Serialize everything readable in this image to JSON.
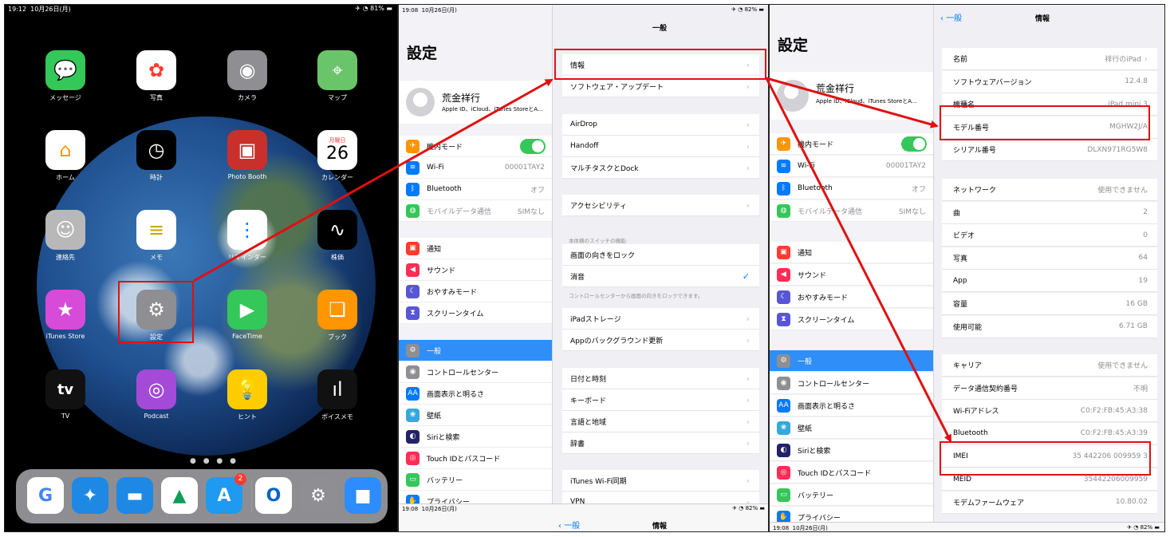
{
  "panel1": {
    "status": {
      "time": "19:12",
      "date": "10月26日(月)",
      "battery": "81%"
    },
    "apps": [
      {
        "label": "メッセージ",
        "icon": "messages-icon",
        "color": "#34c759"
      },
      {
        "label": "写真",
        "icon": "photos-icon",
        "color": "#ffffff"
      },
      {
        "label": "カメラ",
        "icon": "camera-icon",
        "color": "#8e8e93"
      },
      {
        "label": "マップ",
        "icon": "maps-icon",
        "color": "#6ac46a"
      },
      {
        "label": "ホーム",
        "icon": "home-icon",
        "color": "#ffffff"
      },
      {
        "label": "時計",
        "icon": "clock-icon",
        "color": "#000000"
      },
      {
        "label": "Photo Booth",
        "icon": "photobooth-icon",
        "color": "#c9302c"
      },
      {
        "label": "カレンダー",
        "icon": "calendar-icon",
        "color": "#ffffff"
      },
      {
        "label": "連絡先",
        "icon": "contacts-icon",
        "color": "#b8b8b8"
      },
      {
        "label": "メモ",
        "icon": "notes-icon",
        "color": "#ffffff"
      },
      {
        "label": "リマインダー",
        "icon": "reminders-icon",
        "color": "#ffffff"
      },
      {
        "label": "株価",
        "icon": "stocks-icon",
        "color": "#000000"
      },
      {
        "label": "iTunes Store",
        "icon": "star-icon",
        "color": "#d64bd8"
      },
      {
        "label": "設定",
        "icon": "settings-gear-icon",
        "color": "#8e8e93"
      },
      {
        "label": "FaceTime",
        "icon": "facetime-icon",
        "color": "#34c759"
      },
      {
        "label": "ブック",
        "icon": "books-icon",
        "color": "#ff9500"
      },
      {
        "label": "TV",
        "icon": "tv-icon",
        "color": "#111111"
      },
      {
        "label": "Podcast",
        "icon": "podcast-icon",
        "color": "#a34ad8"
      },
      {
        "label": "ヒント",
        "icon": "lightbulb-icon",
        "color": "#ffcc00"
      },
      {
        "label": "ボイスメモ",
        "icon": "voice-memo-icon",
        "color": "#111111"
      }
    ],
    "calendar": {
      "weekday": "月曜日",
      "day": "26"
    },
    "tv_label": "tv",
    "dots": "● ● ● ●",
    "dock": [
      {
        "icon": "google-icon",
        "glyph": "G",
        "color": "#ffffff",
        "fg": "#4285f4"
      },
      {
        "icon": "safari-icon",
        "glyph": "✦",
        "color": "#1e88e5",
        "fg": "#ffffff"
      },
      {
        "icon": "files-icon",
        "glyph": "▬",
        "color": "#1e88e5",
        "fg": "#ffffff"
      },
      {
        "icon": "drive-icon",
        "glyph": "▲",
        "color": "#ffffff",
        "fg": "#0f9d58"
      },
      {
        "icon": "app-store-icon",
        "glyph": "A",
        "color": "#1e9bf0",
        "fg": "#ffffff",
        "badge": "2"
      },
      {
        "icon": "outlook-icon",
        "glyph": "O",
        "color": "#ffffff",
        "fg": "#0a64c4"
      },
      {
        "icon": "settings-gear-icon",
        "glyph": "⚙",
        "color": "#8e8e93",
        "fg": "#ffffff"
      },
      {
        "icon": "zoom-icon",
        "glyph": "■",
        "color": "#2d8cff",
        "fg": "#ffffff"
      }
    ]
  },
  "panel2": {
    "status": {
      "time": "19:08",
      "date": "10月26日(月)",
      "battery": "82%"
    },
    "sidebar_title": "設定",
    "profile": {
      "name": "荒金祥行",
      "sub": "Apple ID、iCloud、iTunes StoreとA..."
    },
    "rows": [
      {
        "label": "機内モード",
        "value": "",
        "color": "#ff9500",
        "glyph": "✈"
      },
      {
        "label": "Wi-Fi",
        "value": "00001TAY2",
        "color": "#007aff",
        "glyph": "≋"
      },
      {
        "label": "Bluetooth",
        "value": "オフ",
        "color": "#007aff",
        "glyph": "ᛒ"
      },
      {
        "label": "モバイルデータ通信",
        "value": "SIMなし",
        "color": "#34c759",
        "glyph": "◍"
      },
      {
        "label": "通知",
        "value": "",
        "color": "#ff3b30",
        "glyph": "▣"
      },
      {
        "label": "サウンド",
        "value": "",
        "color": "#ff2d55",
        "glyph": "◀"
      },
      {
        "label": "おやすみモード",
        "value": "",
        "color": "#5856d6",
        "glyph": "☾"
      },
      {
        "label": "スクリーンタイム",
        "value": "",
        "color": "#5856d6",
        "glyph": "⧗"
      },
      {
        "label": "一般",
        "value": "",
        "color": "#8e8e93",
        "glyph": "⚙"
      },
      {
        "label": "コントロールセンター",
        "value": "",
        "color": "#8e8e93",
        "glyph": "◉"
      },
      {
        "label": "画面表示と明るさ",
        "value": "",
        "color": "#007aff",
        "glyph": "AA"
      },
      {
        "label": "壁紙",
        "value": "",
        "color": "#34aadc",
        "glyph": "❀"
      },
      {
        "label": "Siriと検索",
        "value": "",
        "color": "#222266",
        "glyph": "◐"
      },
      {
        "label": "Touch IDとパスコード",
        "value": "",
        "color": "#ff2d55",
        "glyph": "◎"
      },
      {
        "label": "バッテリー",
        "value": "",
        "color": "#34c759",
        "glyph": "▭"
      },
      {
        "label": "プライバシー",
        "value": "",
        "color": "#007aff",
        "glyph": "✋"
      }
    ],
    "main_title": "一般",
    "main_groups": [
      [
        "情報",
        "ソフトウェア・アップデート"
      ],
      [
        "AirDrop",
        "Handoff",
        "マルチタスクとDock"
      ],
      [
        "アクセシビリティ"
      ],
      [
        "画面の向きをロック",
        "消音"
      ],
      [
        "iPadストレージ",
        "Appのバックグラウンド更新"
      ],
      [
        "日付と時刻",
        "キーボード",
        "言語と地域",
        "辞書"
      ],
      [
        "iTunes Wi-Fi同期",
        "VPN"
      ]
    ],
    "switch_caption": "本体横のスイッチの機能:",
    "switch_note": "コントロールセンターから画面の向きをロックできます。",
    "checkmark": "✓",
    "bottom_status": {
      "time": "19:08",
      "date": "10月26日(月)",
      "battery": "82%"
    },
    "bottom_back": "一般",
    "bottom_title": "情報"
  },
  "panel3": {
    "sidebar_title": "設定",
    "back_label": "一般",
    "title": "情報",
    "info_groups": [
      [
        [
          "名前",
          "祥行のiPad"
        ],
        [
          "ソフトウェアバージョン",
          "12.4.8"
        ],
        [
          "機種名",
          "iPad mini 3"
        ],
        [
          "モデル番号",
          "MGHW2J/A"
        ],
        [
          "シリアル番号",
          "DLXN971RG5W8"
        ]
      ],
      [
        [
          "ネットワーク",
          "使用できません"
        ],
        [
          "曲",
          "2"
        ],
        [
          "ビデオ",
          "0"
        ],
        [
          "写真",
          "64"
        ],
        [
          "App",
          "19"
        ],
        [
          "容量",
          "16 GB"
        ],
        [
          "使用可能",
          "6.71 GB"
        ]
      ],
      [
        [
          "キャリア",
          "使用できません"
        ],
        [
          "データ通信契約番号",
          "不明"
        ],
        [
          "Wi-Fiアドレス",
          "C0:F2:FB:45:A3:38"
        ],
        [
          "Bluetooth",
          "C0:F2:FB:45:A3:39"
        ],
        [
          "IMEI",
          "35 442206 009959 3"
        ],
        [
          "MEID",
          "35442206009959"
        ],
        [
          "モデムファームウェア",
          "10.80.02"
        ]
      ]
    ],
    "bottom_status": {
      "time": "19:08",
      "date": "10月26日(月)",
      "battery": "82%"
    }
  },
  "colors": {
    "highlight": "#e01010",
    "accent": "#2f8ef7",
    "toggle_on": "#34c759"
  }
}
